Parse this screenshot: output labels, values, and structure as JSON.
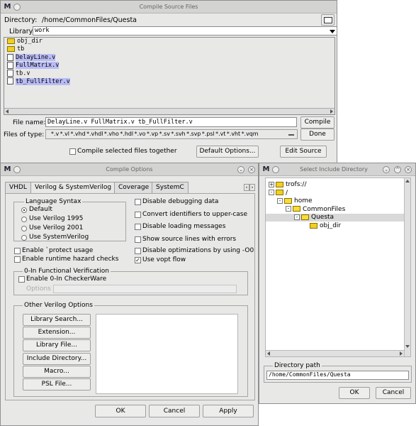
{
  "compile": {
    "title": "Compile Source Files",
    "directory_label": "Directory:",
    "directory_path": "/home/CommonFiles/Questa",
    "library_label": "Library:",
    "library_value": "work",
    "files": [
      {
        "name": "obj_dir",
        "type": "folder",
        "selected": false
      },
      {
        "name": "tb",
        "type": "folder",
        "selected": false
      },
      {
        "name": "DelayLine.v",
        "type": "file",
        "selected": true
      },
      {
        "name": "FullMatrix.v",
        "type": "file",
        "selected": true
      },
      {
        "name": "tb.v",
        "type": "file",
        "selected": false
      },
      {
        "name": "tb_FullFilter.v",
        "type": "file",
        "selected": true
      }
    ],
    "filename_label": "File name:",
    "filename_value": "DelayLine.v FullMatrix.v tb_FullFilter.v",
    "compile_button": "Compile",
    "filetype_label": "Files of type:",
    "filetype_value": "*.v *.vl *.vhd *.vhdl *.vho *.hdl *.vo *.vp *.sv *.svh *.svp *.psl *.vt *.vht *.vqm",
    "done_button": "Done",
    "compile_together_label": "Compile selected files together",
    "default_options_button": "Default Options...",
    "edit_source_button": "Edit Source"
  },
  "options": {
    "title": "Compile Options",
    "tabs": [
      "VHDL",
      "Verilog & SystemVerilog",
      "Coverage",
      "SystemC"
    ],
    "language_syntax_title": "Language Syntax",
    "syntax_options": [
      "Default",
      "Use Verilog 1995",
      "Use Verilog 2001",
      "Use SystemVerilog"
    ],
    "enable_protect": "Enable `protect usage",
    "enable_hazard": "Enable runtime hazard checks",
    "right_checks": [
      {
        "label": "Disable debugging data",
        "checked": false
      },
      {
        "label": "Convert identifiers to upper-case",
        "checked": false
      },
      {
        "label": "Disable loading messages",
        "checked": false
      },
      {
        "label": "Show source lines with errors",
        "checked": false
      },
      {
        "label": "Disable optimizations by using -O0",
        "checked": false
      },
      {
        "label": "Use vopt flow",
        "checked": true
      }
    ],
    "zero_in_title": "0-In Functional Verification",
    "enable_checkerware": "Enable 0-In CheckerWare",
    "options_label": "Options",
    "other_title": "Other Verilog Options",
    "other_buttons": [
      "Library Search...",
      "Extension...",
      "Library File...",
      "Include Directory...",
      "Macro...",
      "PSL File..."
    ],
    "ok_button": "OK",
    "cancel_button": "Cancel",
    "apply_button": "Apply"
  },
  "include": {
    "title": "Select Include Directory",
    "tree": [
      {
        "label": "trofs://",
        "level": 0,
        "expander": "+",
        "open": false,
        "selected": false
      },
      {
        "label": "/",
        "level": 0,
        "expander": "-",
        "open": false,
        "selected": false
      },
      {
        "label": "home",
        "level": 1,
        "expander": "-",
        "open": true,
        "selected": false
      },
      {
        "label": "CommonFiles",
        "level": 2,
        "expander": "-",
        "open": true,
        "selected": false
      },
      {
        "label": "Questa",
        "level": 3,
        "expander": "-",
        "open": true,
        "selected": true
      },
      {
        "label": "obj_dir",
        "level": 4,
        "expander": "",
        "open": false,
        "selected": false
      }
    ],
    "path_title": "Directory path",
    "path_value": "/home/CommonFiles/Questa",
    "ok_button": "OK",
    "cancel_button": "Cancel"
  },
  "icons": {
    "app_logo": "modelsim-logo-icon",
    "folder": "folder-icon",
    "file": "file-icon",
    "new_folder": "new-folder-icon"
  },
  "colors": {
    "window_bg": "#e8e8e7",
    "selection": "#b9bcf4",
    "titlebar": "#d3d3d2"
  }
}
